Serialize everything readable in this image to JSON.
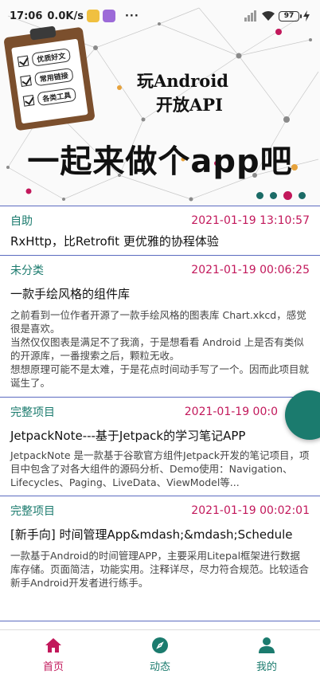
{
  "status_bar": {
    "time": "17:06",
    "net_speed": "0.0K/s",
    "more": "···",
    "battery": "97"
  },
  "banner": {
    "clipboard_items": [
      "优质好文",
      "常用链接",
      "各类工具"
    ],
    "title_line1": "玩Android",
    "title_line2": "开放API",
    "slogan": "一起来做个app吧",
    "indicator_count": 4,
    "indicator_active": 2
  },
  "articles": [
    {
      "chapter": "自助",
      "date": "2021-01-19 13:10:57",
      "title": "RxHttp，比Retrofit 更优雅的协程体验",
      "desc": ""
    },
    {
      "chapter": "未分类",
      "date": "2021-01-19 00:06:25",
      "title": "一款手绘风格的组件库",
      "desc": "之前看到一位作者开源了一款手绘风格的图表库 Chart.xkcd，感觉很是喜欢。\n当然仅仅图表是满足不了我滴，于是想看看 Android 上是否有类似的开源库，一番搜索之后，颗粒无收。\n想想原理可能不是太难，于是花点时间动手写了一个。因而此项目就诞生了。"
    },
    {
      "chapter": "完整项目",
      "date": "2021-01-19 00:0",
      "title": "JetpackNote---基于Jetpack的学习笔记APP",
      "desc": "JetpackNote 是一款基于谷歌官方组件Jetpack开发的笔记项目，项目中包含了对各大组件的源码分析、Demo使用：Navigation、Lifecycles、Paging、LiveData、ViewModel等..."
    },
    {
      "chapter": "完整项目",
      "date": "2021-01-19 00:02:01",
      "title": "[新手向] 时间管理App&mdash;&mdash;Schedule",
      "desc": "一款基于Android的时间管理APP，主要采用Litepal框架进行数据库存储。页面简洁，功能实用。注释详尽，尽力符合规范。比较适合新手Android开发者进行练手。"
    }
  ],
  "bottom_nav": {
    "home": "首页",
    "dynamic": "动态",
    "mine": "我的"
  },
  "colors": {
    "accent": "#c2185b",
    "primary": "#1b7b6e",
    "divider": "#5c6bc0"
  }
}
